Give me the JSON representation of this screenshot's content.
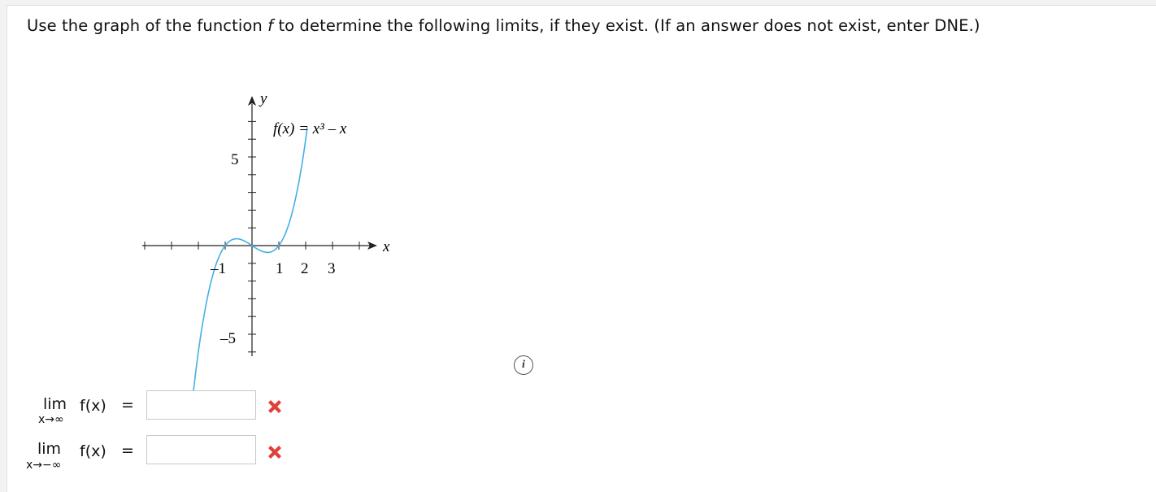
{
  "question": {
    "prompt_before": "Use the graph of the function ",
    "prompt_var": "f",
    "prompt_after": " to determine the following limits, if they exist. (If an answer does not exist, enter DNE.)"
  },
  "graph": {
    "function_label": "f(x) = x³ – x",
    "y_axis_label": "y",
    "x_axis_label": "x",
    "x_tick_labels": [
      "–1",
      "1",
      "2",
      "3"
    ],
    "y_tick_labels": [
      "5",
      "–5"
    ],
    "curve_color": "#45b0e6"
  },
  "info_icon": {
    "icon": "info-icon",
    "glyph": "i"
  },
  "limits": [
    {
      "lim": "lim",
      "sub": "x→∞",
      "fx": "f(x)",
      "eq": "=",
      "value": "",
      "status": "incorrect",
      "status_icon": "x-mark-icon",
      "status_color": "#e0403a"
    },
    {
      "lim": "lim",
      "sub": "x→−∞",
      "fx": "f(x)",
      "eq": "=",
      "value": "",
      "status": "incorrect",
      "status_icon": "x-mark-icon",
      "status_color": "#e0403a"
    }
  ]
}
